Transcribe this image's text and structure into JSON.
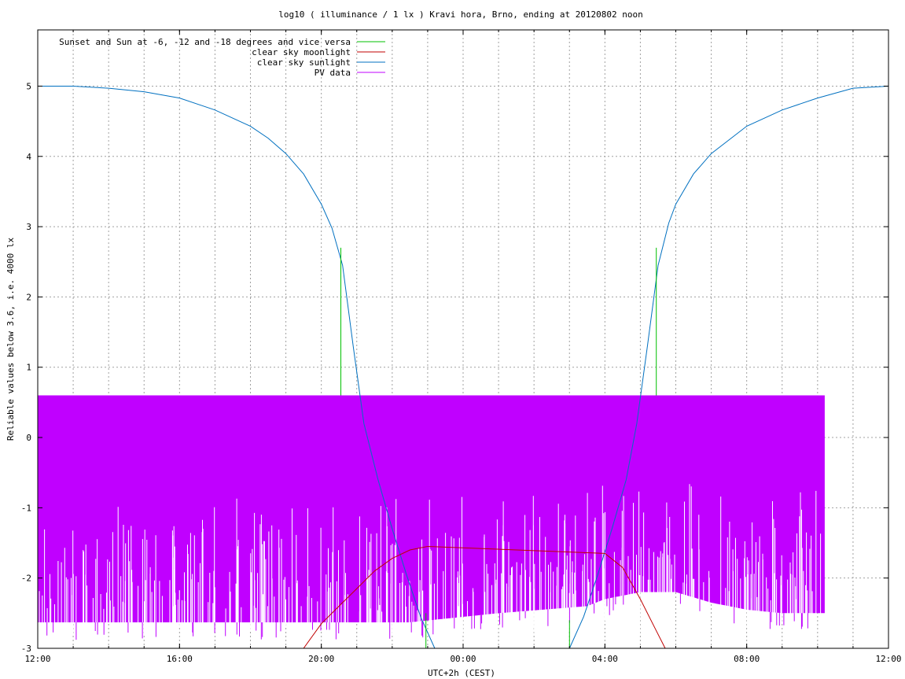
{
  "chart_data": {
    "type": "line",
    "title": "log10 ( illuminance / 1 lx ) Kravi hora, Brno, ending at 20120802 noon",
    "xlabel": "UTC+2h (CEST)",
    "ylabel": "Reliable values below 3.6, i.e. 4000 lx",
    "xlim": [
      12,
      36
    ],
    "ylim": [
      -3,
      5.8
    ],
    "x_ticks": [
      {
        "v": 12,
        "label": "12:00"
      },
      {
        "v": 16,
        "label": "16:00"
      },
      {
        "v": 20,
        "label": "20:00"
      },
      {
        "v": 24,
        "label": "00:00"
      },
      {
        "v": 28,
        "label": "04:00"
      },
      {
        "v": 32,
        "label": "08:00"
      },
      {
        "v": 36,
        "label": "12:00"
      }
    ],
    "y_ticks": [
      {
        "v": 5,
        "label": "5"
      },
      {
        "v": 4,
        "label": "4"
      },
      {
        "v": 3,
        "label": "3"
      },
      {
        "v": 2,
        "label": "2"
      },
      {
        "v": 1,
        "label": "1"
      },
      {
        "v": 0,
        "label": "0"
      },
      {
        "v": -1,
        "label": "-1"
      },
      {
        "v": -2,
        "label": "-2"
      },
      {
        "v": -3,
        "label": "-3"
      }
    ],
    "grid": true,
    "legend_position": "top-left",
    "series": [
      {
        "name": "Sunset and Sun at -6, -12 and -18 degrees and vice versa",
        "color": "#00c000",
        "style": "vertical-markers",
        "x": [
          20.55,
          21.3,
          22.1,
          22.95,
          27.0,
          27.85,
          28.7,
          29.45
        ],
        "y_top": [
          2.7,
          2.7,
          2.7,
          2.7,
          2.7,
          2.7,
          2.7,
          2.7
        ],
        "y_bottom": [
          -3,
          -3,
          -3,
          -3,
          -3,
          -3,
          -3,
          -3
        ],
        "visible_top": [
          2.7,
          0.6,
          0.6,
          -2.5,
          -2.6,
          0.6,
          0.6,
          2.7
        ]
      },
      {
        "name": "clear sky moonlight",
        "color": "#c00000",
        "x": [
          19.5,
          20.0,
          20.5,
          21.0,
          21.5,
          22.0,
          22.5,
          23.0,
          28.0,
          28.5,
          29.0,
          29.4,
          29.7
        ],
        "y": [
          -3.0,
          -2.65,
          -2.4,
          -2.15,
          -1.9,
          -1.72,
          -1.6,
          -1.55,
          -1.65,
          -1.85,
          -2.3,
          -2.7,
          -3.0
        ]
      },
      {
        "name": "clear sky sunlight",
        "color": "#0070c0",
        "x": [
          12.0,
          13.0,
          14.0,
          15.0,
          16.0,
          17.0,
          18.0,
          18.5,
          19.0,
          19.5,
          20.0,
          20.3,
          20.6,
          20.9,
          21.2,
          21.6,
          22.0,
          22.4,
          22.8,
          23.2,
          27.0,
          27.4,
          27.8,
          28.2,
          28.6,
          28.9,
          29.2,
          29.5,
          29.8,
          30.0,
          30.5,
          31.0,
          32.0,
          33.0,
          34.0,
          35.0,
          36.0
        ],
        "y": [
          5.0,
          5.0,
          4.97,
          4.92,
          4.83,
          4.66,
          4.43,
          4.26,
          4.04,
          3.75,
          3.32,
          2.98,
          2.45,
          1.3,
          0.2,
          -0.6,
          -1.3,
          -1.95,
          -2.55,
          -3.0,
          -3.0,
          -2.55,
          -1.95,
          -1.3,
          -0.6,
          0.2,
          1.3,
          2.45,
          3.05,
          3.32,
          3.75,
          4.04,
          4.43,
          4.66,
          4.83,
          4.97,
          5.0
        ]
      },
      {
        "name": "PV data",
        "color": "#c000ff",
        "style": "dense-noise-band",
        "x_start": 12.0,
        "x_end": 34.2,
        "upper": 0.6,
        "lower_x": [
          12.0,
          19.0,
          22.5,
          25.0,
          27.5,
          28.0,
          29.0,
          30.0,
          31.0,
          32.0,
          33.0,
          34.2
        ],
        "lower_y": [
          -2.63,
          -2.63,
          -2.63,
          -2.5,
          -2.4,
          -2.3,
          -2.2,
          -2.2,
          -2.35,
          -2.45,
          -2.5,
          -2.5
        ],
        "spike_min": -2.82
      }
    ]
  }
}
